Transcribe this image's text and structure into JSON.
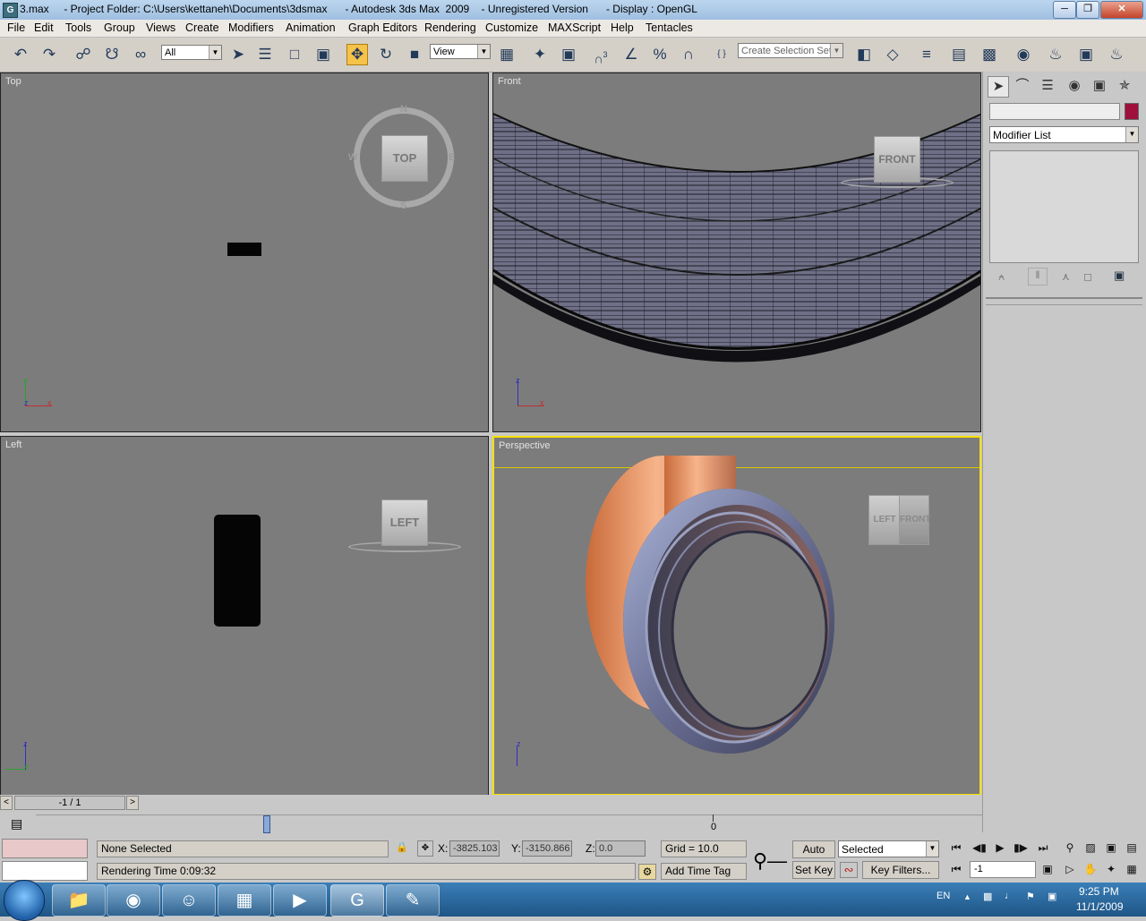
{
  "window": {
    "app_icon": "3ds-max-icon",
    "title": "3.max     - Project Folder: C:\\Users\\kettaneh\\Documents\\3dsmax      - Autodesk 3ds Max  2009    - Unregistered Version      - Display : OpenGL",
    "controls": [
      "minimize-icon",
      "restore-icon",
      "close-icon"
    ]
  },
  "menu": [
    "File",
    "Edit",
    "Tools",
    "Group",
    "Views",
    "Create",
    "Modifiers",
    "Animation",
    "Graph Editors",
    "Rendering",
    "Customize",
    "MAXScript",
    "Help",
    "Tentacles"
  ],
  "toolbar": {
    "selection_filter": "All",
    "reference_coord": "View",
    "named_selection_placeholder": "Create Selection Set",
    "snap_label": "3"
  },
  "viewports": {
    "top": {
      "label": "Top",
      "cube": "TOP",
      "compass": [
        "N",
        "S",
        "W",
        "E"
      ],
      "axes": [
        "y",
        "z",
        "x"
      ]
    },
    "front": {
      "label": "Front",
      "cube": "FRONT",
      "axes": [
        "z",
        "x"
      ]
    },
    "left": {
      "label": "Left",
      "cube": "LEFT",
      "axes": [
        "z",
        "y"
      ]
    },
    "perspective": {
      "label": "Perspective",
      "cube_left": "LEFT",
      "cube_right": "FRONT",
      "axes": [
        "z"
      ]
    }
  },
  "command_panel": {
    "tabs": [
      "create-icon",
      "modify-icon",
      "hierarchy-icon",
      "motion-icon",
      "display-icon",
      "utilities-icon"
    ],
    "name_value": "",
    "object_color": "#a0103c",
    "modifier_list": "Modifier List"
  },
  "time_slider": {
    "frame_label": "-1 / 1",
    "ruler_label": "0"
  },
  "status": {
    "selection": "None Selected",
    "prompt": "Rendering Time  0:09:32",
    "x_label": "X:",
    "x_value": "-3825.103",
    "y_label": "Y:",
    "y_value": "-3150.866",
    "z_label": "Z:",
    "z_value": "0.0",
    "grid": "Grid = 10.0",
    "add_time_tag": "Add Time Tag",
    "auto_key": "Auto Key",
    "set_key": "Set Key",
    "key_mode": "Selected",
    "key_filters": "Key Filters...",
    "current_frame": "-1"
  },
  "taskbar": {
    "apps": [
      "windows-explorer-icon",
      "firefox-icon",
      "messenger-icon",
      "calculator-icon",
      "media-player-icon",
      "3ds-max-icon",
      "paint-icon"
    ],
    "language": "EN",
    "time": "9:25 PM",
    "date": "11/1/2009"
  }
}
